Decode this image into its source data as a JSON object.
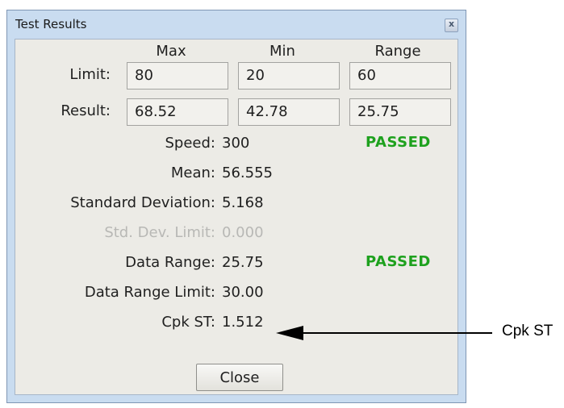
{
  "window": {
    "title": "Test Results",
    "close_glyph": "x"
  },
  "headers": {
    "max": "Max",
    "min": "Min",
    "range": "Range"
  },
  "limit": {
    "label": "Limit:",
    "max": "80",
    "min": "20",
    "range": "60"
  },
  "result": {
    "label": "Result:",
    "max": "68.52",
    "min": "42.78",
    "range": "25.75"
  },
  "stats": {
    "speed": {
      "label": "Speed:",
      "value": "300",
      "status": "PASSED"
    },
    "mean": {
      "label": "Mean:",
      "value": "56.555"
    },
    "std_dev": {
      "label": "Standard Deviation:",
      "value": "5.168"
    },
    "std_dev_limit": {
      "label": "Std. Dev. Limit:",
      "value": "0.000"
    },
    "data_range": {
      "label": "Data Range:",
      "value": "25.75",
      "status": "PASSED"
    },
    "data_range_limit": {
      "label": "Data Range Limit:",
      "value": "30.00"
    },
    "cpk_st": {
      "label": "Cpk ST:",
      "value": "1.512"
    }
  },
  "close_button": {
    "label": "Close"
  },
  "annotation": {
    "label": "Cpk ST"
  },
  "colors": {
    "passed": "#1ea11e",
    "window_frame": "#c9dcf0",
    "client_bg": "#ecebe6"
  }
}
